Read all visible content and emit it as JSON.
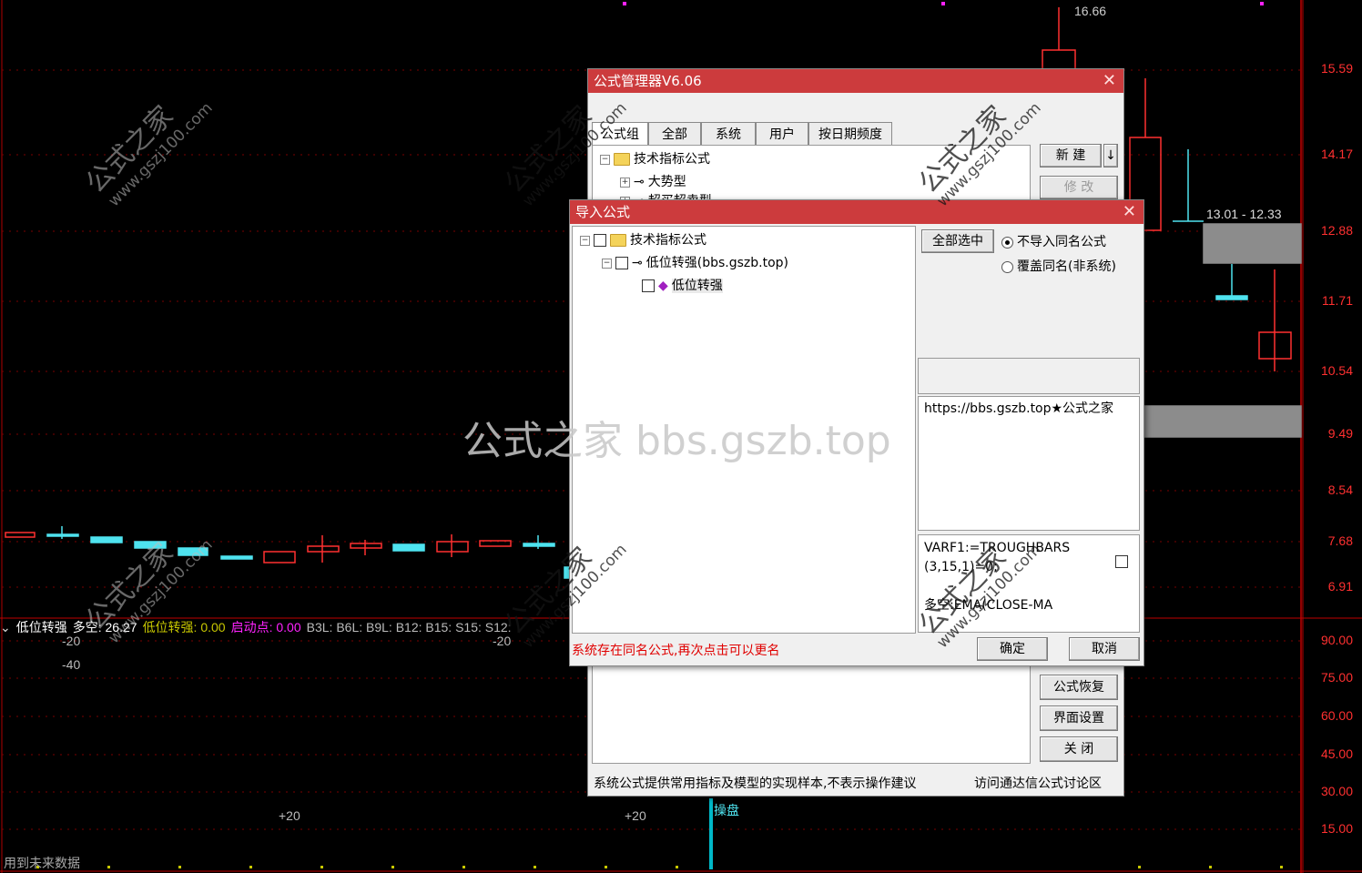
{
  "chart": {
    "price_axis": [
      "15.59",
      "14.17",
      "12.88",
      "11.71",
      "10.54",
      "9.49",
      "8.54",
      "7.68",
      "6.91"
    ],
    "indicator_axis": [
      "90.00",
      "75.00",
      "60.00",
      "45.00",
      "30.00",
      "15.00"
    ],
    "high_label": "16.66",
    "range_label": "13.01 - 12.33",
    "indicator_bar": {
      "name": "低位转强",
      "duokong_label": "多空: ",
      "duokong_value": "26.27",
      "dwzq_label": "低位转强: ",
      "dwzq_value": "0.00",
      "qdd_label": "启动点: ",
      "qdd_value": "0.00",
      "rest": "B3L:  B6L:  B9L:  B12:  B15:  S15:  S12:"
    },
    "neg20_left": "-20",
    "neg40": "-40",
    "neg20_mid": "-20",
    "plus20_left": "+20",
    "plus20_mid": "+20",
    "caopan": "操盘",
    "bottom_note": "用到未来数据",
    "colors": {
      "up": "#ff3030",
      "down": "#4fe3ef",
      "axis": "#ff3030",
      "indicator_dwzq": "#c8c800",
      "indicator_qdd": "#ff22ff"
    }
  },
  "manager": {
    "title": "公式管理器V6.06",
    "tabs": [
      "公式组",
      "全部",
      "系统",
      "用户",
      "按日期频度"
    ],
    "tree": [
      {
        "label": "技术指标公式"
      },
      {
        "label": "大势型"
      },
      {
        "label": "超买超卖型"
      }
    ],
    "buttons": {
      "new": "新 建",
      "arrow": "↓",
      "modify": "修 改",
      "restore": "公式恢复",
      "ui_settings": "界面设置",
      "close": "关 闭"
    },
    "footer_left": "系统公式提供常用指标及模型的实现样本,不表示操作建议",
    "footer_right": "访问通达信公式讨论区"
  },
  "import": {
    "title": "导入公式",
    "tree": [
      {
        "label": "技术指标公式"
      },
      {
        "label": "低位转强(bbs.gszb.top)"
      },
      {
        "label": "低位转强"
      }
    ],
    "select_all": "全部选中",
    "radio_no_import": "不导入同名公式",
    "radio_overwrite": "覆盖同名(非系统)",
    "desc_text": "https://bbs.gszb.top★公式之家",
    "code_line1": "VARF1:=TROUGHBARS",
    "code_line2": "(3,15,1)=0;",
    "code_line3": "多空:EMA(CLOSE-MA",
    "warning": "系统存在同名公式,再次点击可以更名",
    "ok": "确定",
    "cancel": "取消"
  },
  "watermark": {
    "site": "公式之家 bbs.gszb.top",
    "diag_cn": "公式之家",
    "diag_url": "www.gszj100.com"
  }
}
